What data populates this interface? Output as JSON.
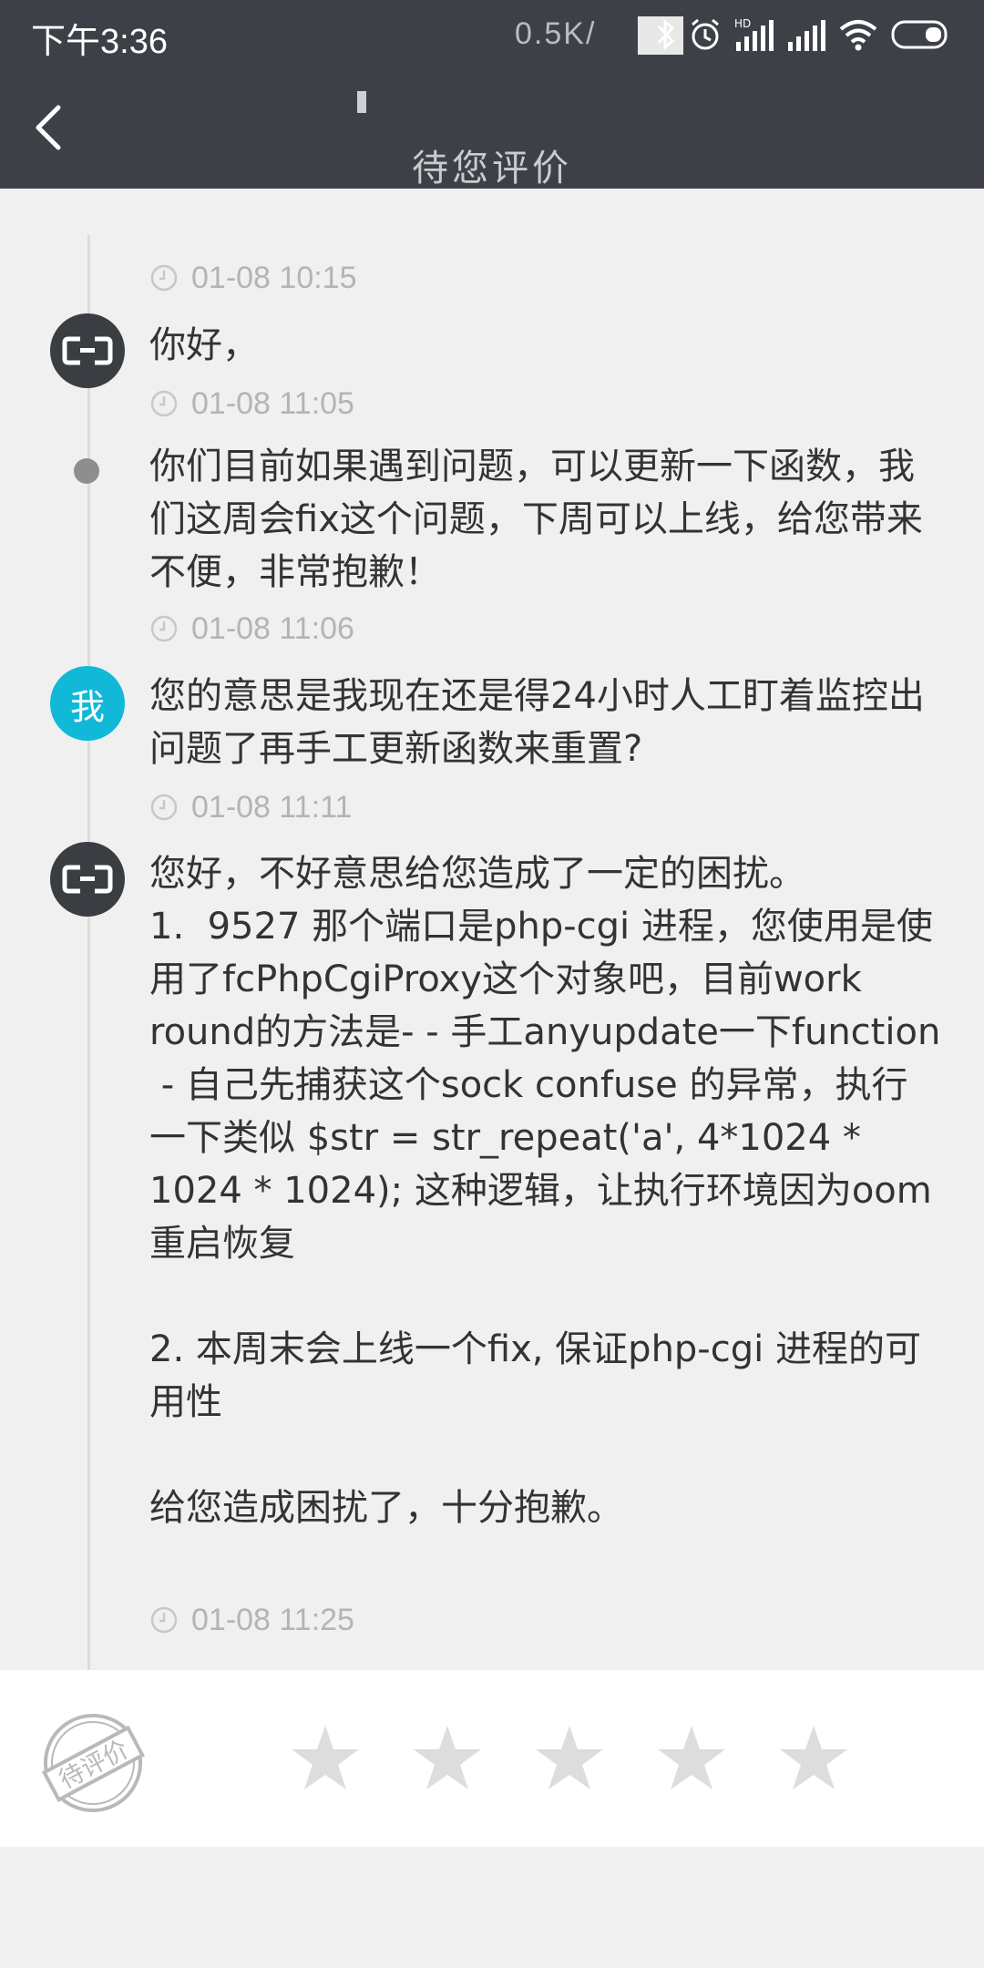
{
  "status_bar": {
    "time": "下午3:36",
    "network_speed": "0.5K/",
    "icons": [
      "bluetooth-icon",
      "alarm-icon",
      "hd-signal-icon",
      "signal-icon",
      "wifi-icon",
      "battery-icon"
    ]
  },
  "header": {
    "title": "待您评价",
    "back_icon": "chevron-left-icon"
  },
  "messages": [
    {
      "sender": "",
      "text": "",
      "time": "01-08 10:15"
    },
    {
      "sender": "service",
      "text": "你好，",
      "time": "01-08 11:05"
    },
    {
      "sender": "service-continued",
      "text": "你们目前如果遇到问题，可以更新一下函数，我们这周会fix这个问题，下周可以上线，给您带来不便，非常抱歉！",
      "time": "01-08 11:06"
    },
    {
      "sender": "me",
      "avatar_label": "我",
      "text": "您的意思是我现在还是得24小时人工盯着监控出问题了再手工更新函数来重置?",
      "time": "01-08 11:11"
    },
    {
      "sender": "service",
      "text": "您好，不好意思给您造成了一定的困扰。\n1.  9527 那个端口是php-cgi 进程，您使用是使用了fcPhpCgiProxy这个对象吧，目前work round的方法是- - 手工anyupdate一下function\n - 自己先捕获这个sock confuse 的异常，执行一下类似 $str = str_repeat('a', 4*1024 * 1024 * 1024); 这种逻辑，让执行环境因为oom重启恢复\n\n2. 本周末会上线一个fix, 保证php-cgi 进程的可用性\n\n给您造成困扰了，十分抱歉。",
      "time": "01-08 11:25"
    }
  ],
  "rating": {
    "stamp_text": "待评价",
    "stars": 5,
    "selected": 0
  },
  "colors": {
    "header_bg": "#3d4147",
    "page_bg": "#f0f0f0",
    "me_avatar": "#12b8d8",
    "service_avatar": "#3a3d42",
    "star_empty": "#dddddd"
  }
}
